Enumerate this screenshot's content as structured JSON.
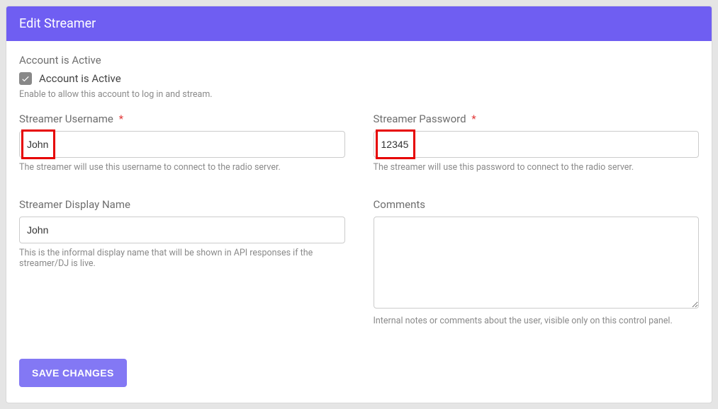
{
  "header": {
    "title": "Edit Streamer"
  },
  "fields": {
    "active": {
      "label": "Account is Active",
      "checkbox_label": "Account is Active",
      "checked": true,
      "hint": "Enable to allow this account to log in and stream."
    },
    "username": {
      "label": "Streamer Username",
      "required_mark": "*",
      "value": "John",
      "hint": "The streamer will use this username to connect to the radio server."
    },
    "password": {
      "label": "Streamer Password",
      "required_mark": "*",
      "value": "12345",
      "hint": "The streamer will use this password to connect to the radio server."
    },
    "display_name": {
      "label": "Streamer Display Name",
      "value": "John",
      "hint": "This is the informal display name that will be shown in API responses if the streamer/DJ is live."
    },
    "comments": {
      "label": "Comments",
      "value": "",
      "hint": "Internal notes or comments about the user, visible only on this control panel."
    }
  },
  "buttons": {
    "save": "SAVE CHANGES"
  }
}
